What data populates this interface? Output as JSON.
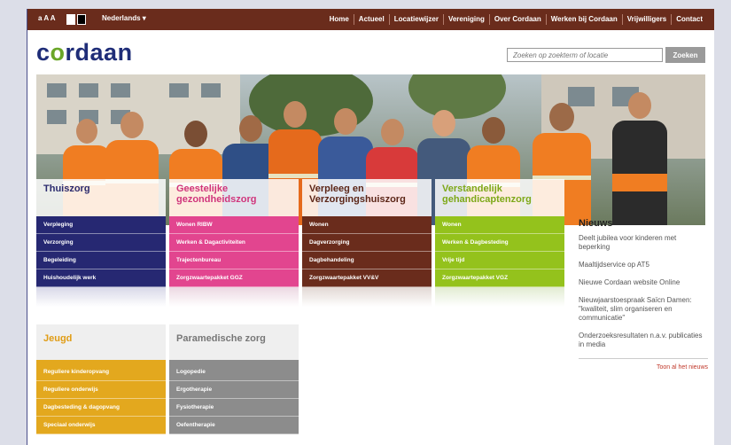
{
  "topbar": {
    "font_size_control": "a A A",
    "language": "Nederlands ▾",
    "nav": [
      "Home",
      "Actueel",
      "Locatiewijzer",
      "Vereniging",
      "Over Cordaan",
      "Werken bij Cordaan",
      "Vrijwilligers",
      "Contact"
    ]
  },
  "logo": {
    "text_pre": "c",
    "text_o": "o",
    "text_post": "rdaan"
  },
  "search": {
    "placeholder": "Zoeken op zoekterm of locatie",
    "button": "Zoeken"
  },
  "categories": [
    {
      "title": "Thuiszorg",
      "color": "#262872",
      "title_color": "#2b2b6e",
      "links": [
        "Verpleging",
        "Verzorging",
        "Begeleiding",
        "Huishoudelijk werk"
      ]
    },
    {
      "title": "Geestelijke gezondheidszorg",
      "color": "#e2458f",
      "title_color": "#d0357c",
      "links": [
        "Wonen RIBW",
        "Werken & Dagactiviteiten",
        "Trajectenbureau",
        "Zorgzwaartepakket GGZ"
      ]
    },
    {
      "title": "Verpleeg en Verzorgingshuiszorg",
      "color": "#6a2c1c",
      "title_color": "#5c2618",
      "links": [
        "Wonen",
        "Dagverzorging",
        "Dagbehandeling",
        "Zorgzwaartepakket VV&V"
      ]
    },
    {
      "title": "Verstandelijk gehandicaptenzorg",
      "color": "#94c21c",
      "title_color": "#7da818",
      "links": [
        "Wonen",
        "Werken & Dagbesteding",
        "Vrije tijd",
        "Zorgzwaartepakket VGZ"
      ]
    }
  ],
  "lower": [
    {
      "title": "Jeugd",
      "color": "#e3a81e",
      "title_color": "#e09c14",
      "links": [
        "Reguliere kinderopvang",
        "Reguliere onderwijs",
        "Dagbesteding & dagopvang",
        "Speciaal onderwijs"
      ]
    },
    {
      "title": "Paramedische zorg",
      "color": "#8c8c8c",
      "title_color": "#777777",
      "links": [
        "Logopedie",
        "Ergotherapie",
        "Fysiotherapie",
        "Oefentherapie"
      ]
    }
  ],
  "news": {
    "title": "Nieuws",
    "items": [
      "Deelt jubilea voor kinderen met beperking",
      "Maaltijdservice op AT5",
      "Nieuwe Cordaan website Online",
      "Nieuwjaarstoespraak Saïcn Damen: \"kwaliteit, slim organiseren en communicatie\"",
      "Onderzoeksresultaten n.a.v. publicaties in media"
    ],
    "all_link": "Toon al het nieuws"
  }
}
